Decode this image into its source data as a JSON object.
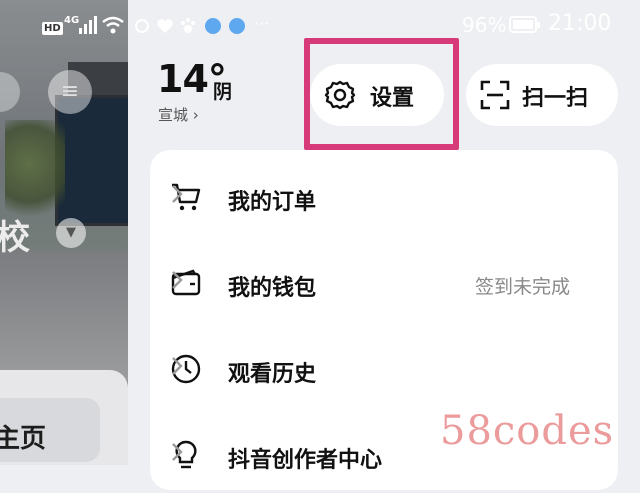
{
  "status_bar": {
    "hd_label": "HD",
    "network_label": "4G",
    "battery": "96",
    "time": "21:00"
  },
  "background": {
    "school_label": "校",
    "homepage_label": "主页"
  },
  "weather": {
    "temperature": "14°",
    "condition": "阴",
    "city": "宣城 ›"
  },
  "quick_actions": {
    "settings_label": "设置",
    "scan_label": "扫一扫"
  },
  "menu": {
    "items": [
      {
        "label": "我的订单",
        "status": ""
      },
      {
        "label": "我的钱包",
        "status": "签到未完成"
      },
      {
        "label": "观看历史",
        "status": ""
      },
      {
        "label": "抖音创作者中心",
        "status": ""
      }
    ]
  },
  "watermark": "58codes",
  "colors": {
    "highlight": "#d63a78",
    "background": "#eeeff2",
    "card": "#ffffff"
  }
}
